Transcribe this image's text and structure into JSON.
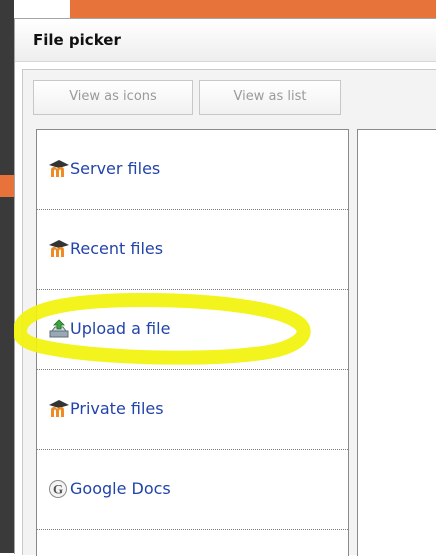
{
  "dialog": {
    "title": "File picker"
  },
  "view_toggle": {
    "icons_label": "View as icons",
    "list_label": "View as list"
  },
  "repositories": [
    {
      "label": "Server files",
      "icon": "moodle-icon"
    },
    {
      "label": "Recent files",
      "icon": "moodle-icon"
    },
    {
      "label": "Upload a file",
      "icon": "upload-icon"
    },
    {
      "label": "Private files",
      "icon": "moodle-icon"
    },
    {
      "label": "Google Docs",
      "icon": "google-icon"
    }
  ],
  "colors": {
    "link": "#2244aa",
    "moodle_orange": "#e8733a",
    "highlight": "#f2f20a"
  }
}
